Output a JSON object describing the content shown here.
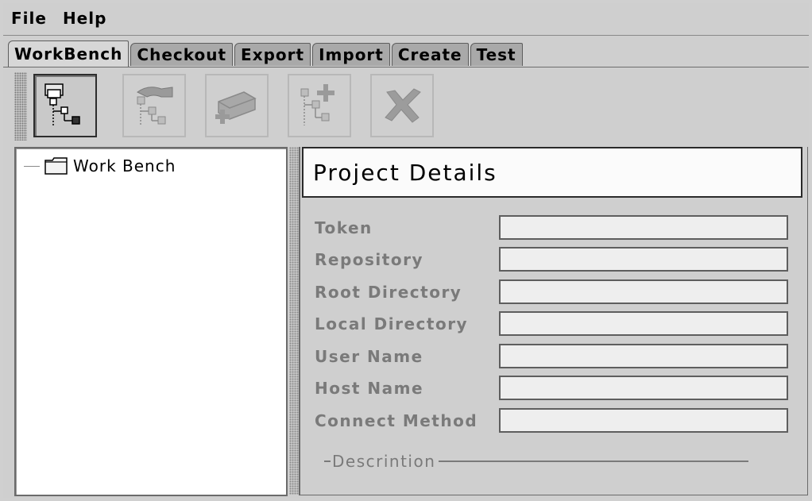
{
  "menu": [
    "File",
    "Help"
  ],
  "tabs": [
    "WorkBench",
    "Checkout",
    "Export",
    "Import",
    "Create",
    "Test"
  ],
  "toolbar": {
    "icons": [
      "open-tree-icon",
      "link-tree-icon",
      "add-module-icon",
      "add-tree-node-icon",
      "delete-icon"
    ]
  },
  "tree": {
    "root_label": "Work Bench"
  },
  "details": {
    "title": "Project Details",
    "fields": [
      "Token",
      "Repository",
      "Root Directory",
      "Local Directory",
      "User Name",
      "Host Name",
      "Connect Method"
    ],
    "description_label": "Descrintion"
  }
}
